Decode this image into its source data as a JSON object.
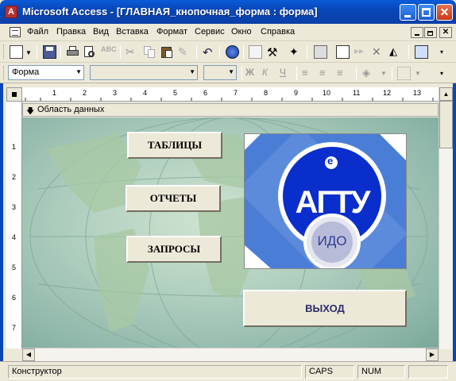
{
  "window": {
    "app_icon_letter": "A",
    "title": "Microsoft Access - [ГЛАВНАЯ_кнопочная_форма : форма]"
  },
  "menu": {
    "items": [
      "Файл",
      "Правка",
      "Вид",
      "Вставка",
      "Формат",
      "Сервис",
      "Окно",
      "Справка"
    ]
  },
  "toolbar2": {
    "object_combo": "Форма",
    "font_combo": "",
    "size_combo": ""
  },
  "section": {
    "label": "Область данных"
  },
  "ruler_h": {
    "ticks": [
      "1",
      "2",
      "3",
      "4",
      "5",
      "6",
      "7",
      "8",
      "9",
      "10",
      "11",
      "12",
      "13"
    ]
  },
  "ruler_v": {
    "ticks": [
      "1",
      "2",
      "3",
      "4",
      "5",
      "6",
      "7"
    ]
  },
  "form": {
    "buttons": {
      "tables": "ТАБЛИЦЫ",
      "reports": "ОТЧЕТЫ",
      "queries": "ЗАПРОСЫ",
      "exit": "ВЫХОД"
    },
    "logo": {
      "letters": "АГТУ",
      "badge": "ИДО",
      "top_letter": "е"
    },
    "colors": {
      "exit_text": "#2b2b6b",
      "logo_blue": "#0a2ecc",
      "logo_bg_blue": "#4a7dd6"
    }
  },
  "status": {
    "mode": "Конструктор",
    "caps": "CAPS",
    "num": "NUM"
  }
}
